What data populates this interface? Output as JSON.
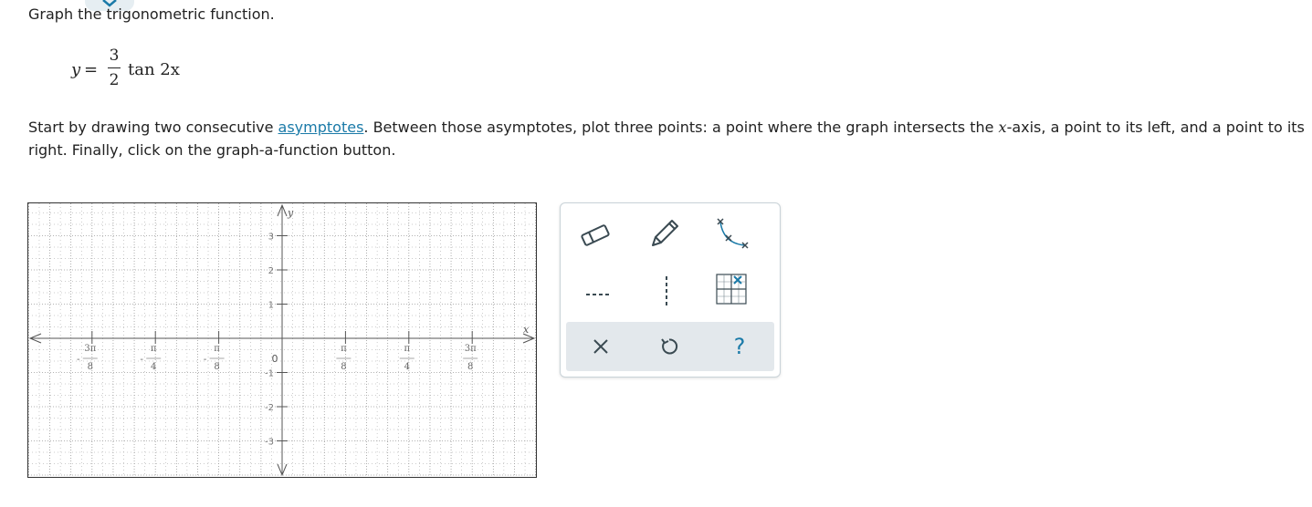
{
  "header": {
    "title": "Graph the trigonometric function."
  },
  "equation": {
    "lhs": "y",
    "equals": "=",
    "numerator": "3",
    "denominator": "2",
    "function": "tan 2x"
  },
  "instructions": {
    "part1": "Start by drawing two consecutive ",
    "link": "asymptotes",
    "part2": ". Between those asymptotes, plot three points: a point where the graph intersects the ",
    "xvar": "x",
    "part3": "-axis, a point to its left, and a point to its right. Finally, click on the graph-a-function button."
  },
  "graph": {
    "x_axis_label": "x",
    "y_axis_label": "y",
    "y_tick_labels": [
      "3",
      "2",
      "1",
      "-1",
      "-2",
      "-3"
    ],
    "y_tick_values": [
      3,
      2,
      1,
      -1,
      -2,
      -3
    ],
    "origin_label": "0",
    "x_tick_labels": [
      {
        "sign": "-",
        "num": "3π",
        "den": "8",
        "value": -3
      },
      {
        "sign": "-",
        "num": "π",
        "den": "4",
        "value": -2
      },
      {
        "sign": "-",
        "num": "π",
        "den": "8",
        "value": -1
      },
      {
        "sign": "",
        "num": "π",
        "den": "8",
        "value": 1
      },
      {
        "sign": "",
        "num": "π",
        "den": "4",
        "value": 2
      },
      {
        "sign": "",
        "num": "3π",
        "den": "8",
        "value": 3
      }
    ],
    "colors": {
      "grid": "#9a9a9a",
      "axis": "#555555"
    }
  },
  "tools": {
    "eraser": "eraser-icon",
    "pencil": "pencil-icon",
    "curve": "curve-icon",
    "asymptote_horizontal": "dashed-horizontal-line-icon",
    "asymptote_vertical": "dashed-vertical-line-icon",
    "graph_function": "graph-function-icon",
    "clear": "close-icon",
    "undo": "undo-icon",
    "help": "?"
  },
  "colors": {
    "accent": "#1a7aa8",
    "tool_stroke": "#3a4a52"
  }
}
